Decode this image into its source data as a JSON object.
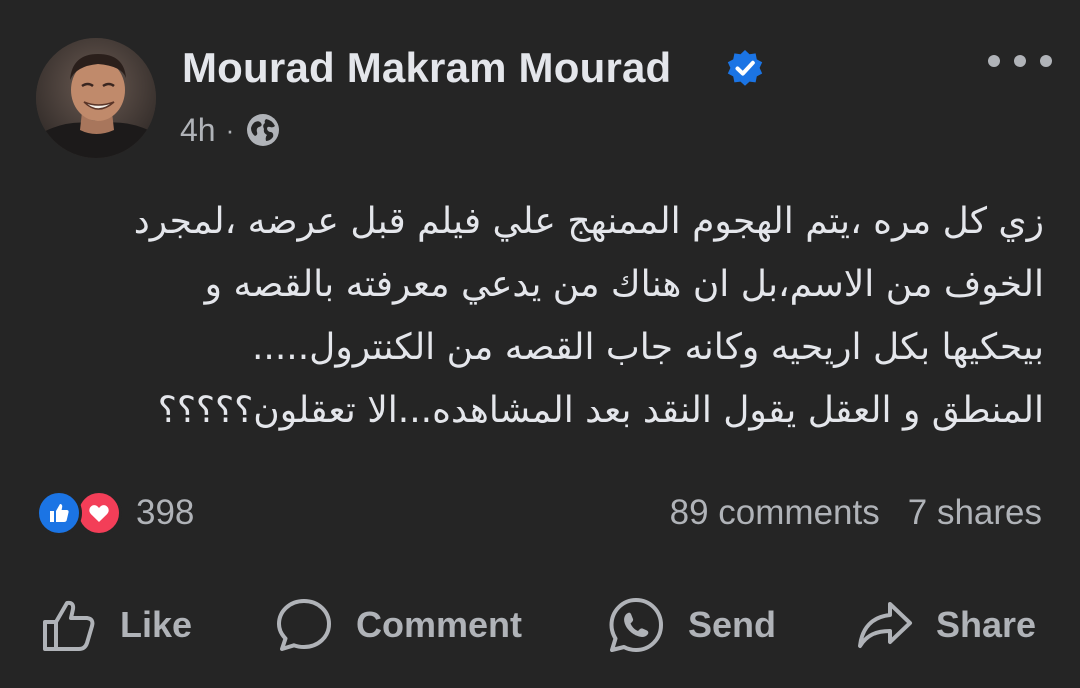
{
  "post": {
    "author": "Mourad Makram Mourad",
    "verified": true,
    "time": "4h",
    "separator": "·",
    "audience_icon": "globe-icon",
    "more_icon": "more-horizontal-icon",
    "text_lines": [
      "زي كل مره ،يتم الهجوم الممنهج علي فيلم قبل عرضه ،لمجرد",
      "الخوف من الاسم،بل ان هناك من يدعي معرفته بالقصه و",
      "بيحكيها بكل اريحيه وكانه جاب القصه من الكنترول.....",
      "المنطق و العقل يقول النقد بعد المشاهده...الا تعقلون؟؟؟؟؟"
    ]
  },
  "stats": {
    "reaction_icons": [
      "like-reaction-icon",
      "love-reaction-icon"
    ],
    "reaction_count": "398",
    "comments": "89 comments",
    "shares": "7 shares"
  },
  "actions": {
    "like": "Like",
    "comment": "Comment",
    "send": "Send",
    "share": "Share"
  },
  "colors": {
    "background": "#252525",
    "primary_text": "#e4e6eb",
    "secondary_text": "#b0b3b8",
    "verified_badge": "#1b74e4",
    "like_reaction": "#1b74e4",
    "love_reaction": "#f33e58"
  }
}
